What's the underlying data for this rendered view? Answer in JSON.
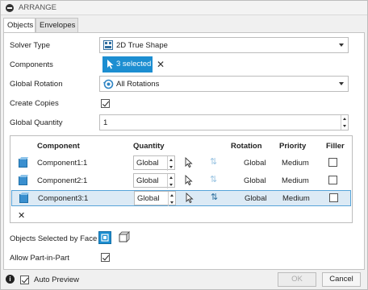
{
  "dialog": {
    "title": "ARRANGE"
  },
  "tabs": [
    {
      "label": "Objects"
    },
    {
      "label": "Envelopes"
    }
  ],
  "solver_type": {
    "label": "Solver Type",
    "value": "2D True Shape"
  },
  "components": {
    "label": "Components",
    "selection": "3 selected"
  },
  "global_rotation": {
    "label": "Global Rotation",
    "value": "All Rotations"
  },
  "create_copies": {
    "label": "Create Copies",
    "checked": true
  },
  "global_quantity": {
    "label": "Global Quantity",
    "value": "1"
  },
  "table": {
    "headers": {
      "component": "Component",
      "quantity": "Quantity",
      "rotation": "Rotation",
      "priority": "Priority",
      "filler": "Filler"
    },
    "rows": [
      {
        "name": "Component1:1",
        "quantity": "Global",
        "rotation": "Global",
        "priority": "Medium",
        "filler": false,
        "selected": false
      },
      {
        "name": "Component2:1",
        "quantity": "Global",
        "rotation": "Global",
        "priority": "Medium",
        "filler": false,
        "selected": false
      },
      {
        "name": "Component3:1",
        "quantity": "Global",
        "rotation": "Global",
        "priority": "Medium",
        "filler": false,
        "selected": true
      }
    ]
  },
  "objects_selected_by_face": {
    "label": "Objects Selected by Face"
  },
  "allow_part_in_part": {
    "label": "Allow Part-in-Part",
    "checked": true
  },
  "footer": {
    "auto_preview_label": "Auto Preview",
    "ok_label": "OK",
    "cancel_label": "Cancel"
  },
  "colors": {
    "accent": "#1c8ed1",
    "selected_row": "#dceaf5"
  }
}
